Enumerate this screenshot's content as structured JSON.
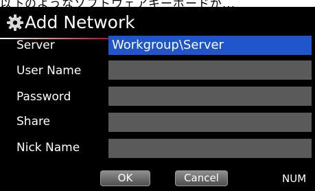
{
  "caption": "以下のようなソフトウェアキーボードが...",
  "dialog": {
    "title": "Add Network",
    "title_icon": "gear-icon"
  },
  "fields": [
    {
      "key": "server",
      "label": "Server",
      "value": "Workgroup\\Server",
      "focused": true
    },
    {
      "key": "user_name",
      "label": "User Name",
      "value": ""
    },
    {
      "key": "password",
      "label": "Password",
      "value": ""
    },
    {
      "key": "share",
      "label": "Share",
      "value": ""
    },
    {
      "key": "nick_name",
      "label": "Nick Name",
      "value": ""
    }
  ],
  "buttons": {
    "ok": "OK",
    "cancel": "Cancel"
  },
  "input_mode": "NUM",
  "colors": {
    "background": "#000000",
    "focused_field": "#1f55c8",
    "field": "#5a5a5a",
    "accent_divider": "#c01818"
  }
}
